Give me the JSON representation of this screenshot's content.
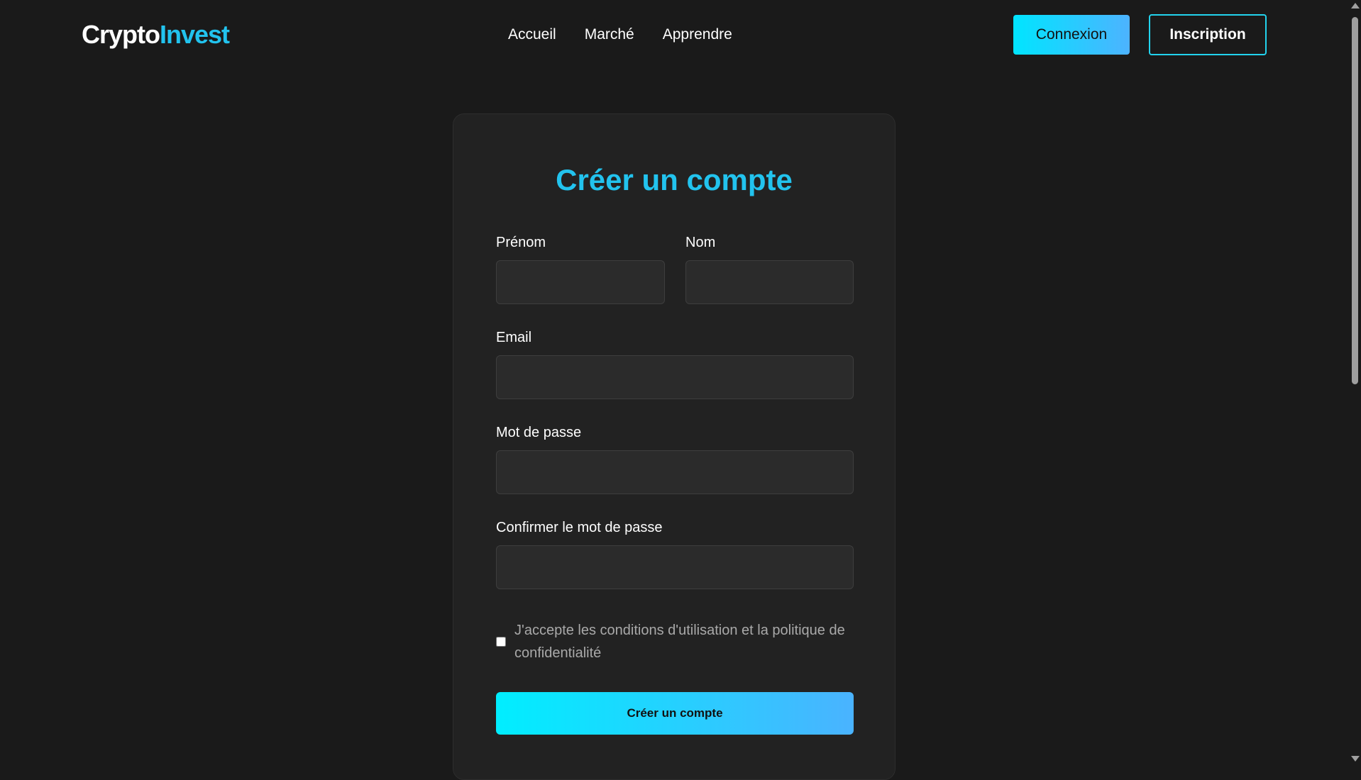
{
  "header": {
    "logo_part1": "Crypto",
    "logo_part2": "Invest",
    "nav": [
      {
        "label": "Accueil"
      },
      {
        "label": "Marché"
      },
      {
        "label": "Apprendre"
      }
    ],
    "login_label": "Connexion",
    "signup_label": "Inscription"
  },
  "form": {
    "title": "Créer un compte",
    "first_name_label": "Prénom",
    "first_name_value": "",
    "last_name_label": "Nom",
    "last_name_value": "",
    "email_label": "Email",
    "email_value": "",
    "password_label": "Mot de passe",
    "password_value": "",
    "confirm_label": "Confirmer le mot de passe",
    "confirm_value": "",
    "terms_text": "J'accepte les conditions d'utilisation et la politique de confidentialité",
    "terms_checked": false,
    "submit_label": "Créer un compte"
  },
  "colors": {
    "background": "#1a1a1a",
    "card": "#222222",
    "accent": "#22c3ee",
    "gradient_start": "#00e5ff",
    "gradient_end": "#4db3ff"
  }
}
